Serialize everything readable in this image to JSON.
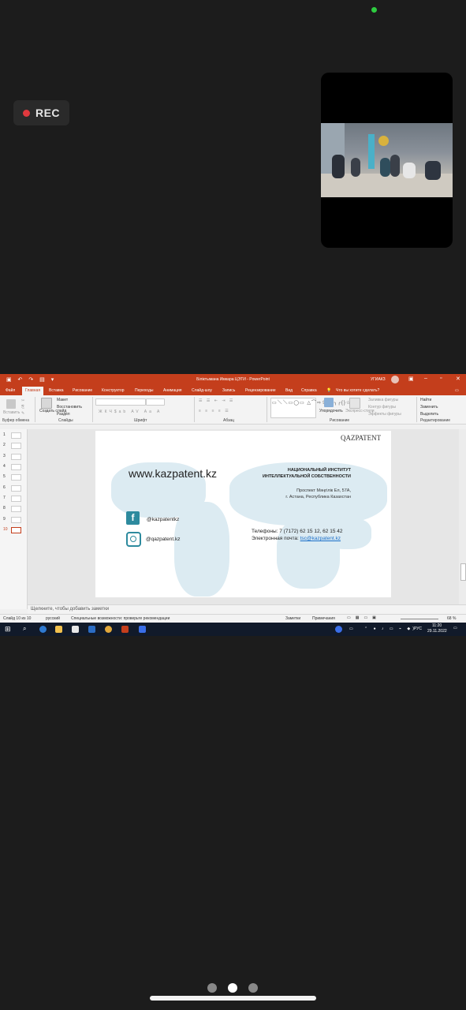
{
  "meeting": {
    "rec_label": "REC"
  },
  "ppt": {
    "title": "Біліктымана Имкара ЦЭТИ - PowerPoint",
    "user": "УГИАКЗ",
    "tabs": [
      "Файл",
      "Главная",
      "Вставка",
      "Рисование",
      "Конструктор",
      "Переходы",
      "Анимация",
      "Слайд-шоу",
      "Запись",
      "Рецензирование",
      "Вид",
      "Справка"
    ],
    "active_tab": "Главная",
    "tell_me": "Что вы хотите сделать?",
    "ribbon": {
      "paste": "Вставить",
      "layout": "Макет",
      "reset": "Восстановить",
      "section": "Раздел",
      "new_slide": "Создать слайд",
      "arrange": "Упорядочить",
      "quick_styles": "Экспресс-стили",
      "fill": "Заливка фигуры",
      "outline": "Контур фигуры",
      "effects": "Эффекты фигуры",
      "find": "Найти",
      "replace": "Заменить",
      "select": "Выделить",
      "groups": [
        "Буфер обмена",
        "Слайды",
        "Шрифт",
        "Абзац",
        "Рисование",
        "Редактирование"
      ]
    },
    "slide_numbers": [
      "1",
      "2",
      "3",
      "4",
      "5",
      "6",
      "7",
      "8",
      "9",
      "10"
    ],
    "selected_slide": "10",
    "slide": {
      "logo": "QAZPATENT",
      "website": "www.kazpatent.kz",
      "org_line1": "НАЦИОНАЛЬНЫЙ ИНСТИТУТ",
      "org_line2": "ИНТЕЛЛЕКТУАЛЬНОЙ СОБСТВЕННОСТИ",
      "addr_line1": "Проспект Мәңгілік Ел, 57А,",
      "addr_line2": "г. Астана, Республика Казахстан",
      "phone": "Телефоны: 7 (7172) 62 15 12, 62 15 42",
      "email_label": "Электронная почта:",
      "email": "tsc@kazpatent.kz",
      "facebook": "@kazpatentkz",
      "instagram": "@qazpatent.kz"
    },
    "notes_placeholder": "Щелкните, чтобы добавить заметки",
    "status": {
      "slide_count": "Слайд 10 из 10",
      "language": "русский",
      "accessibility": "Специальные возможности: проверьте рекомендации",
      "notes": "Заметки",
      "comments": "Примечания",
      "zoom": "68 %"
    },
    "taskbar": {
      "lang": "РУС",
      "time": "11:20",
      "date": "29.11.2022"
    }
  }
}
